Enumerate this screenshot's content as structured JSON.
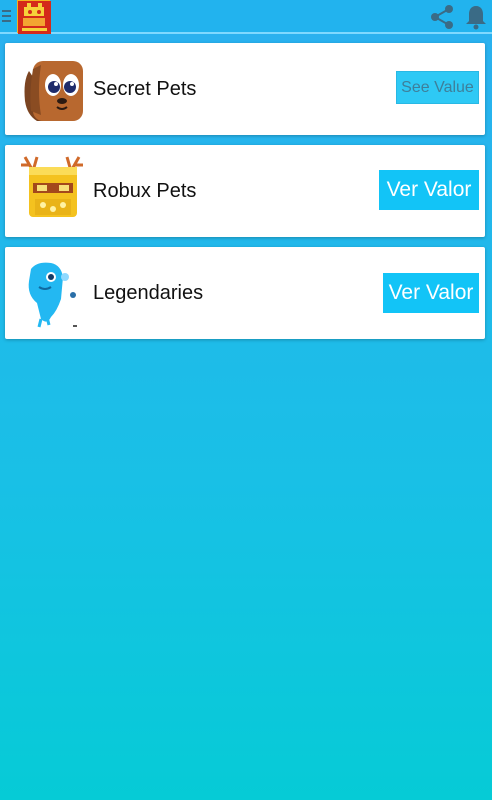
{
  "topbar": {
    "menu_icon": "hamburger-menu-icon",
    "logo": "app-logo-icon",
    "actions": [
      "share-icon",
      "bell-icon"
    ],
    "colors": {
      "bar": "#22b3ee",
      "accent": "#12c4f7"
    }
  },
  "items": [
    {
      "label": "Secret Pets",
      "button": "See Value",
      "icon": "brown-puppy-pet-icon"
    },
    {
      "label": "Robux Pets",
      "button": "Ver Valor",
      "icon": "golden-antler-pet-icon"
    },
    {
      "label": "Legendaries",
      "button": "Ver Valor",
      "icon": "blue-ghost-pet-icon"
    }
  ]
}
